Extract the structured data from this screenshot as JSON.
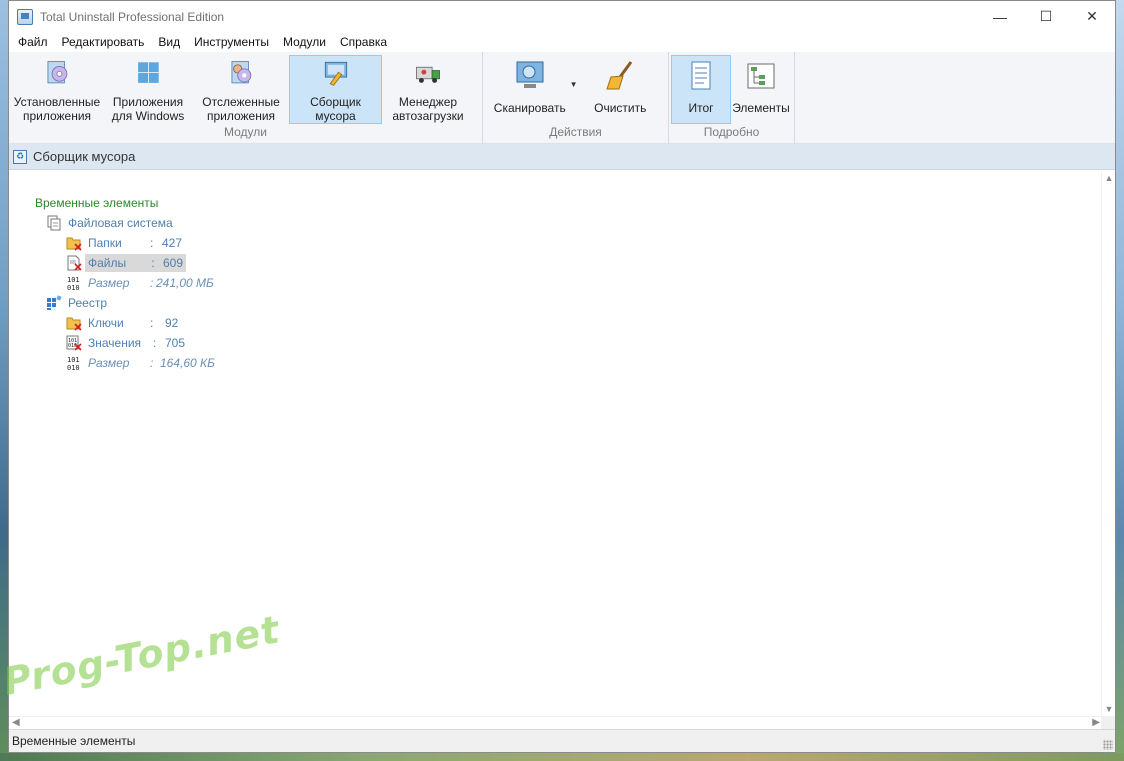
{
  "window": {
    "title": "Total Uninstall Professional Edition",
    "controls": {
      "minimize": "—",
      "maximize": "☐",
      "close": "✕"
    }
  },
  "menu": [
    "Файл",
    "Редактировать",
    "Вид",
    "Инструменты",
    "Модули",
    "Справка"
  ],
  "ribbon": {
    "modules": {
      "label": "Модули",
      "buttons": [
        {
          "line1": "Установленные",
          "line2": "приложения",
          "icon": "installed-apps-icon"
        },
        {
          "line1": "Приложения",
          "line2": "для Windows",
          "icon": "windows-apps-icon"
        },
        {
          "line1": "Отслеженные",
          "line2": "приложения",
          "icon": "monitored-apps-icon"
        },
        {
          "line1": "Сборщик",
          "line2": "мусора",
          "icon": "junk-collector-icon",
          "active": true
        },
        {
          "line1": "Менеджер",
          "line2": "автозагрузки",
          "icon": "startup-manager-icon"
        }
      ]
    },
    "actions": {
      "label": "Действия",
      "buttons": [
        {
          "line1": "Сканировать",
          "line2": "",
          "icon": "scan-icon"
        },
        {
          "line1": "Очистить",
          "line2": "",
          "icon": "broom-icon"
        }
      ]
    },
    "details": {
      "label": "Подробно",
      "buttons": [
        {
          "line1": "Итог",
          "line2": "",
          "icon": "summary-icon",
          "active": true
        },
        {
          "line1": "Элементы",
          "line2": "",
          "icon": "elements-icon"
        }
      ]
    }
  },
  "breadcrumb": {
    "title": "Сборщик мусора"
  },
  "tree": {
    "root": "Временные элементы",
    "filesystem": {
      "label": "Файловая система",
      "rows": [
        {
          "label": "Папки",
          "sep": ":",
          "value": "427"
        },
        {
          "label": "Файлы",
          "sep": ":",
          "value": "609"
        },
        {
          "label": "Размер",
          "sep": ":",
          "value": "241,00 МБ"
        }
      ]
    },
    "registry": {
      "label": "Реестр",
      "rows": [
        {
          "label": "Ключи",
          "sep": ":",
          "value": "92"
        },
        {
          "label": "Значения",
          "sep": ":",
          "value": "705"
        },
        {
          "label": "Размер",
          "sep": ":",
          "value": "164,60 КБ"
        }
      ]
    }
  },
  "status": {
    "text": "Временные элементы"
  },
  "watermark": "Prog-Top.net",
  "colors": {
    "accent": "#cce4f7",
    "tree_green": "#2a8a2a",
    "tree_blue": "#4f7faf"
  }
}
